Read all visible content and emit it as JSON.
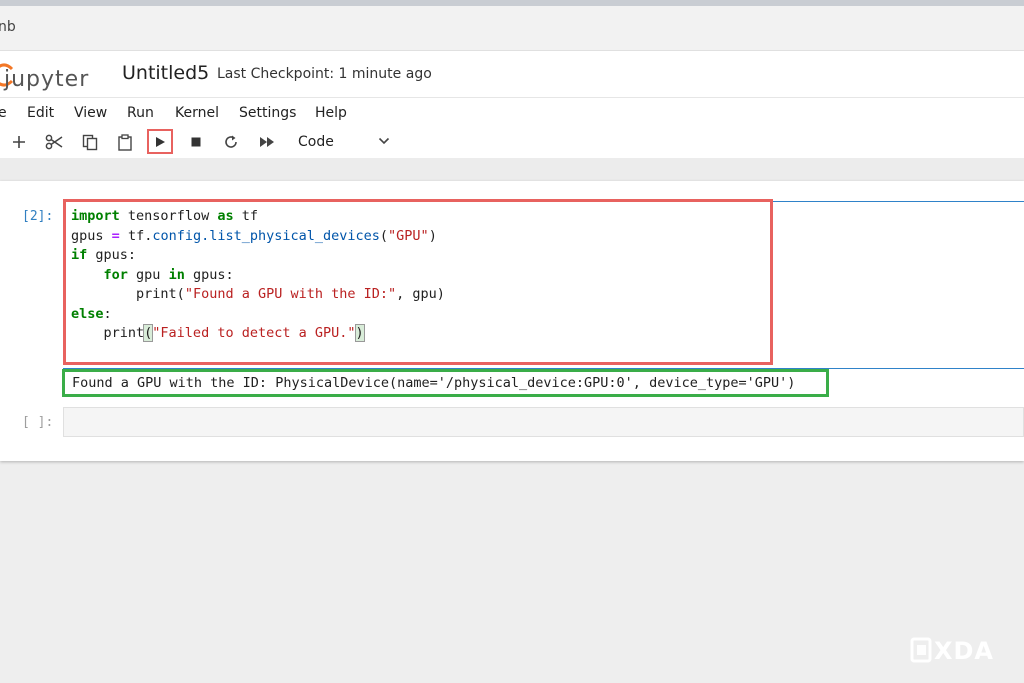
{
  "tab": {
    "title_fragment": "nb"
  },
  "header": {
    "logo_text": "jupyter",
    "notebook_title": "Untitled5",
    "checkpoint": "Last Checkpoint: 1 minute ago"
  },
  "menu": [
    "e",
    "Edit",
    "View",
    "Run",
    "Kernel",
    "Settings",
    "Help"
  ],
  "toolbar": {
    "buttons": [
      {
        "name": "add-cell",
        "icon": "plus-icon"
      },
      {
        "name": "cut",
        "icon": "scissors-icon"
      },
      {
        "name": "copy",
        "icon": "copy-icon"
      },
      {
        "name": "paste",
        "icon": "clipboard-icon"
      },
      {
        "name": "run",
        "icon": "play-icon"
      },
      {
        "name": "interrupt",
        "icon": "stop-icon"
      },
      {
        "name": "restart",
        "icon": "refresh-icon"
      },
      {
        "name": "run-all",
        "icon": "fast-forward-icon"
      }
    ],
    "cell_type": "Code"
  },
  "cells": [
    {
      "prompt": "[2]:",
      "code_lines": [
        "import tensorflow as tf",
        "gpus = tf.config.list_physical_devices(\"GPU\")",
        "if gpus:",
        "    for gpu in gpus:",
        "        print(\"Found a GPU with the ID:\", gpu)",
        "else:",
        "    print(\"Failed to detect a GPU.\")"
      ],
      "output": "Found a GPU with the ID: PhysicalDevice(name='/physical_device:GPU:0', device_type='GPU')"
    },
    {
      "prompt": "[ ]:"
    }
  ],
  "highlights": {
    "code_box": "#e8625f",
    "output_box": "#3aad48",
    "run_button_box": "#e8625f"
  },
  "watermark": "XDA"
}
